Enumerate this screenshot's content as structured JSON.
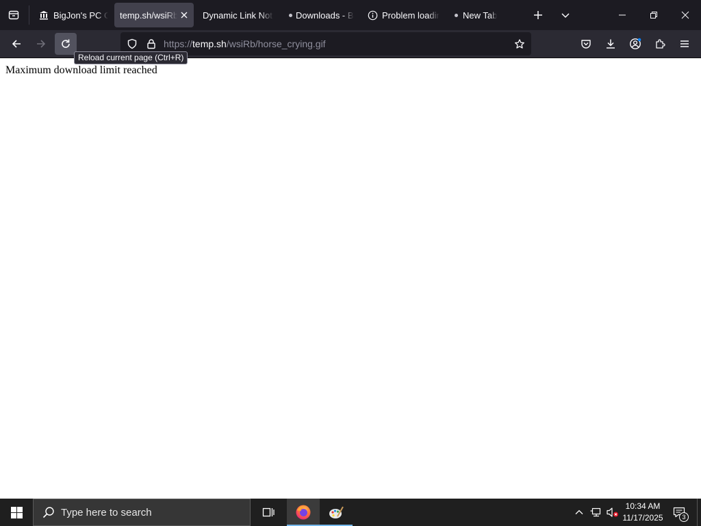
{
  "browser": {
    "tabs": [
      {
        "title": "BigJon's PC Ga",
        "icon": "museum-icon",
        "active": false
      },
      {
        "title": "temp.sh/wsiRb/",
        "icon": "none",
        "active": true
      },
      {
        "title": "Dynamic Link Not F",
        "icon": "none",
        "active": false
      },
      {
        "title": "Downloads - B",
        "icon": "dot-icon",
        "active": false
      },
      {
        "title": "Problem loadin",
        "icon": "info-icon",
        "active": false
      },
      {
        "title": "New Tab",
        "icon": "dot-icon",
        "active": false
      }
    ],
    "address": {
      "scheme": "https://",
      "host": "temp.sh",
      "path": "/wsiRb/horse_crying.gif"
    },
    "tooltip": "Reload current page (Ctrl+R)"
  },
  "page": {
    "message": "Maximum download limit reached"
  },
  "taskbar": {
    "search_placeholder": "Type here to search",
    "time": "10:34 AM",
    "date": "11/17/2025",
    "notification_count": "3"
  },
  "colors": {
    "tabstrip_bg": "#1c1b22",
    "toolbar_bg": "#2b2a33",
    "urlbar_bg": "#1c1b22",
    "active_tab_bg": "#42414d",
    "taskbar_bg": "#1f1f1f",
    "taskbar_accent": "#76b9ed"
  }
}
